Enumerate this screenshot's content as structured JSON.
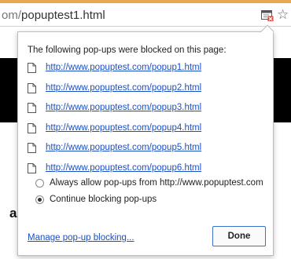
{
  "browser": {
    "url_prefix": "om/",
    "url_rest": "popuptest1.html",
    "icons": [
      "popup-blocked-icon",
      "bookmark-star-icon"
    ]
  },
  "page": {
    "fragment_text": "a"
  },
  "popup_blocker": {
    "header": "The following pop-ups were blocked on this page:",
    "links": [
      "http://www.popuptest.com/popup1.html",
      "http://www.popuptest.com/popup2.html",
      "http://www.popuptest.com/popup3.html",
      "http://www.popuptest.com/popup4.html",
      "http://www.popuptest.com/popup5.html",
      "http://www.popuptest.com/popup6.html"
    ],
    "options": [
      {
        "label": "Always allow pop-ups from http://www.popuptest.com",
        "selected": false
      },
      {
        "label": "Continue blocking pop-ups",
        "selected": true
      }
    ],
    "manage_label": "Manage pop-up blocking...",
    "done_label": "Done"
  },
  "colors": {
    "link": "#1a4fc4",
    "button_border": "#3d72c9",
    "top_stripe": "#e8a850"
  }
}
